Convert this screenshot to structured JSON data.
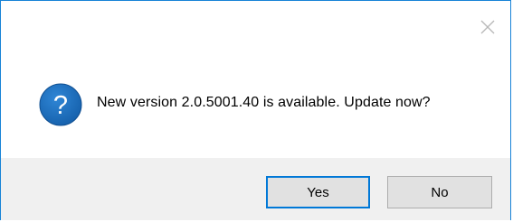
{
  "dialog": {
    "message": "New version 2.0.5001.40 is available. Update now?",
    "icon": "question-icon",
    "close_icon": "close-icon"
  },
  "buttons": {
    "yes_label": "Yes",
    "no_label": "No"
  },
  "colors": {
    "accent": "#0078d7",
    "icon_blue": "#1866b4",
    "footer_bg": "#f0f0f0"
  }
}
